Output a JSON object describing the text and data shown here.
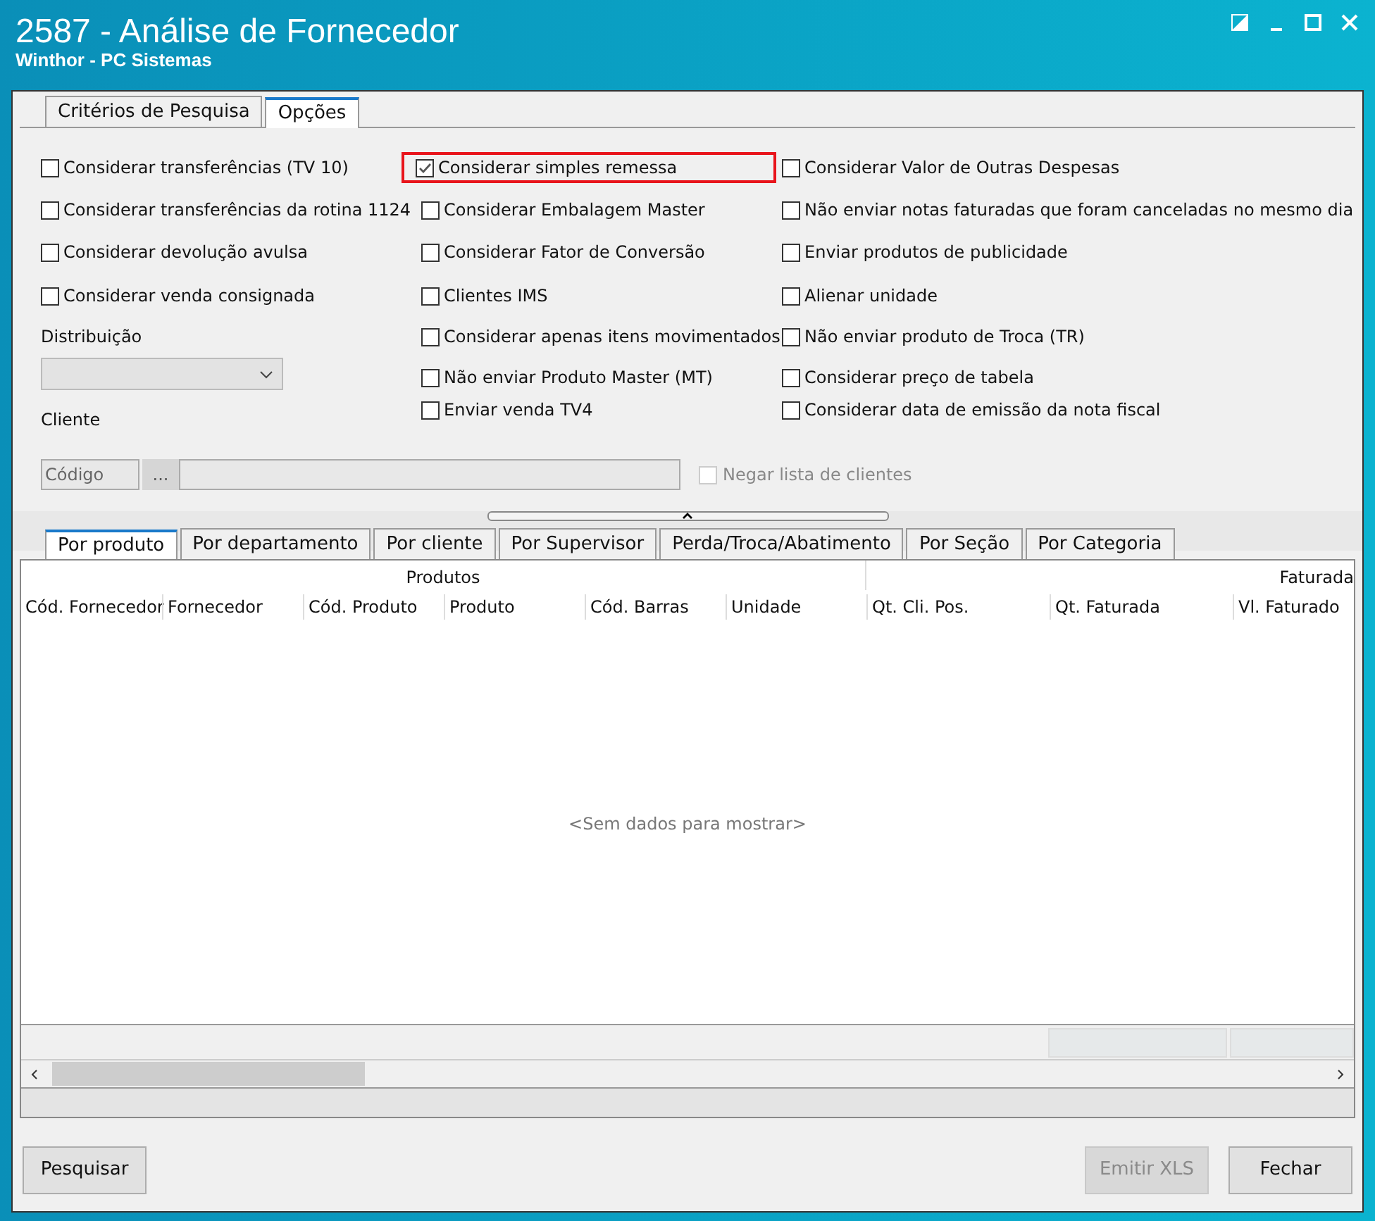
{
  "window": {
    "title": "2587 - Análise de Fornecedor",
    "subtitle": "Winthor - PC Sistemas"
  },
  "tabs": [
    {
      "label": "Critérios de Pesquisa",
      "selected": false
    },
    {
      "label": "Opções",
      "selected": true
    }
  ],
  "options": {
    "columns": [
      [
        {
          "label": "Considerar transferências (TV 10)",
          "checked": false,
          "highlighted": false
        },
        {
          "label": "Considerar transferências da rotina 1124",
          "checked": false,
          "highlighted": false
        },
        {
          "label": "Considerar devolução avulsa",
          "checked": false,
          "highlighted": false
        },
        {
          "label": "Considerar venda consignada",
          "checked": false,
          "highlighted": false
        }
      ],
      [
        {
          "label": "Considerar simples remessa",
          "checked": true,
          "highlighted": true
        },
        {
          "label": "Considerar Embalagem Master",
          "checked": false,
          "highlighted": false
        },
        {
          "label": "Considerar Fator de Conversão",
          "checked": false,
          "highlighted": false
        },
        {
          "label": "Clientes IMS",
          "checked": false,
          "highlighted": false
        },
        {
          "label": "Considerar apenas itens movimentados",
          "checked": false,
          "highlighted": false
        },
        {
          "label": "Não enviar Produto Master (MT)",
          "checked": false,
          "highlighted": false
        },
        {
          "label": "Enviar venda TV4",
          "checked": false,
          "highlighted": false
        }
      ],
      [
        {
          "label": "Considerar Valor de Outras Despesas",
          "checked": false,
          "highlighted": false
        },
        {
          "label": "Não enviar notas faturadas que foram canceladas no mesmo dia",
          "checked": false,
          "highlighted": false
        },
        {
          "label": "Enviar produtos de publicidade",
          "checked": false,
          "highlighted": false
        },
        {
          "label": "Alienar unidade",
          "checked": false,
          "highlighted": false
        },
        {
          "label": "Não enviar produto de Troca (TR)",
          "checked": false,
          "highlighted": false
        },
        {
          "label": "Considerar preço de tabela",
          "checked": false,
          "highlighted": false
        },
        {
          "label": "Considerar data de emissão da nota fiscal",
          "checked": false,
          "highlighted": false
        }
      ]
    ],
    "distribuicao": {
      "label": "Distribuição"
    },
    "cliente": {
      "label": "Cliente",
      "placeholder": "Código",
      "lookup": "..."
    },
    "negar": {
      "label": "Negar lista de clientes",
      "checked": false,
      "disabled": true
    }
  },
  "result_tabs": [
    {
      "label": "Por produto",
      "selected": true
    },
    {
      "label": "Por departamento",
      "selected": false
    },
    {
      "label": "Por cliente",
      "selected": false
    },
    {
      "label": "Por Supervisor",
      "selected": false
    },
    {
      "label": "Perda/Troca/Abatimento",
      "selected": false
    },
    {
      "label": "Por Seção",
      "selected": false
    },
    {
      "label": "Por Categoria",
      "selected": false
    }
  ],
  "table": {
    "bands": [
      "Produtos",
      "Faturada"
    ],
    "columns": [
      "Cód. Fornecedor",
      "Fornecedor",
      "Cód. Produto",
      "Produto",
      "Cód. Barras",
      "Unidade",
      "Qt. Cli. Pos.",
      "Qt. Faturada",
      "Vl. Faturado"
    ],
    "empty_message": "<Sem dados para mostrar>"
  },
  "buttons": [
    {
      "label": "Pesquisar",
      "disabled": false
    },
    {
      "label": "Emitir XLS",
      "disabled": true
    },
    {
      "label": "Fechar",
      "disabled": false
    }
  ]
}
